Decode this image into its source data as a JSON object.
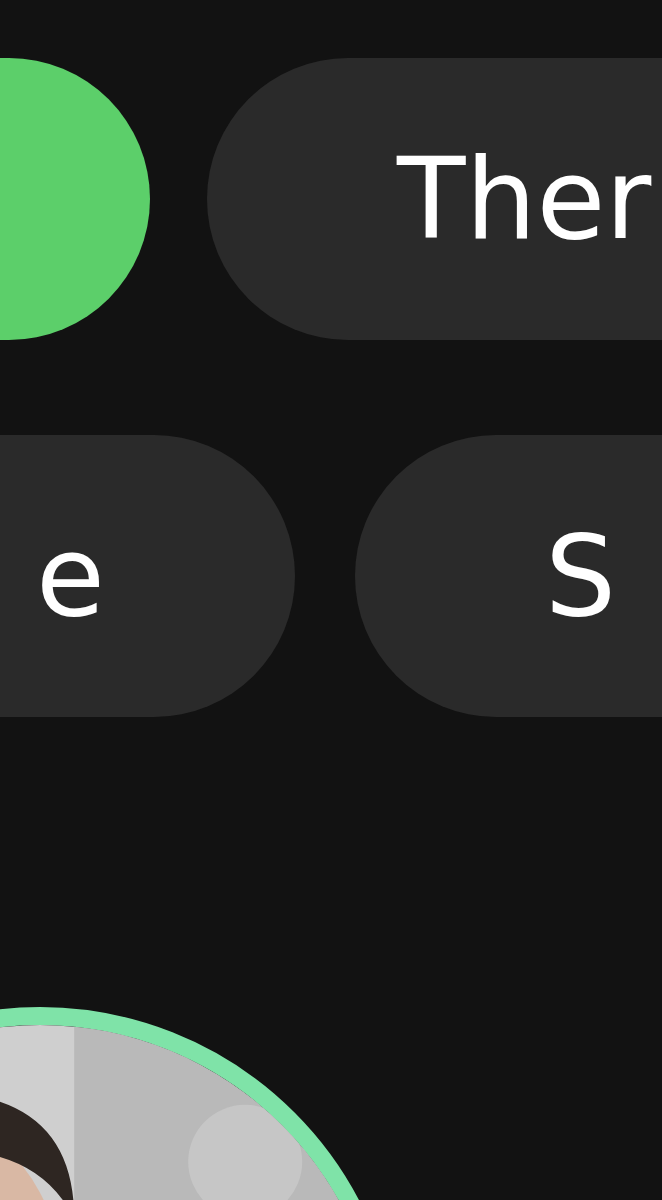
{
  "chip_rows": [
    {
      "chips": [
        {
          "selected": true
        },
        {
          "label": "Ther",
          "selected": false
        }
      ]
    },
    {
      "chips": [
        {
          "label": "e",
          "selected": false
        },
        {
          "label": "S",
          "selected": false
        }
      ]
    }
  ]
}
